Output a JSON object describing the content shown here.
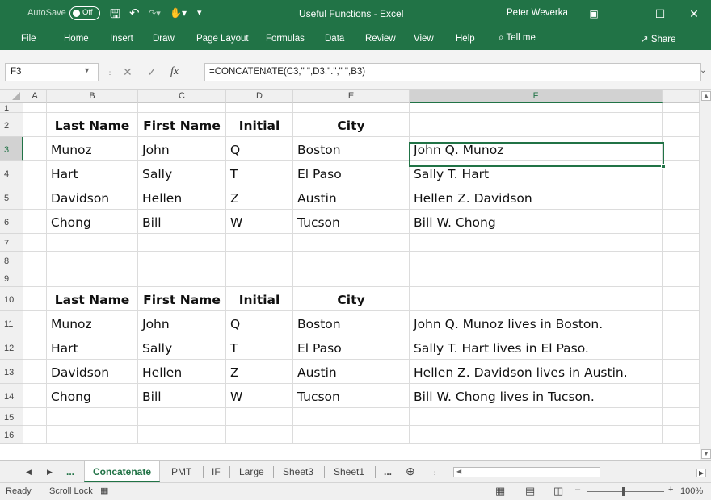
{
  "titlebar": {
    "autosave_label": "AutoSave",
    "autosave_state": "Off",
    "save_icon": "save-icon",
    "undo_icon": "undo-icon",
    "redo_icon": "redo-icon",
    "doc_title": "Useful Functions - Excel",
    "user_name": "Peter Weverka",
    "accent": "#217346"
  },
  "ribbon": {
    "tabs": [
      "File",
      "Home",
      "Insert",
      "Draw",
      "Page Layout",
      "Formulas",
      "Data",
      "Review",
      "View",
      "Help"
    ],
    "tell_me": "Tell me",
    "share": "Share"
  },
  "formula_bar": {
    "name_box": "F3",
    "fx": "fx",
    "formula": "=CONCATENATE(C3,\" \",D3,\".\",\" \",B3)"
  },
  "columns": [
    "A",
    "B",
    "C",
    "D",
    "E",
    "F"
  ],
  "rows": [
    "1",
    "2",
    "3",
    "4",
    "5",
    "6",
    "7",
    "8",
    "9",
    "10",
    "11",
    "12",
    "13",
    "14",
    "15",
    "16"
  ],
  "table1": {
    "headers": [
      "Last Name",
      "First Name",
      "Initial",
      "City"
    ],
    "rows": [
      [
        "Munoz",
        "John",
        "Q",
        "Boston",
        "John Q. Munoz"
      ],
      [
        "Hart",
        "Sally",
        "T",
        "El Paso",
        "Sally T. Hart"
      ],
      [
        "Davidson",
        "Hellen",
        "Z",
        "Austin",
        "Hellen Z. Davidson"
      ],
      [
        "Chong",
        "Bill",
        "W",
        "Tucson",
        "Bill W. Chong"
      ]
    ]
  },
  "table2": {
    "headers": [
      "Last Name",
      "First Name",
      "Initial",
      "City"
    ],
    "rows": [
      [
        "Munoz",
        "John",
        "Q",
        "Boston",
        "John Q. Munoz lives in Boston."
      ],
      [
        "Hart",
        "Sally",
        "T",
        "El Paso",
        "Sally T. Hart lives in El Paso."
      ],
      [
        "Davidson",
        "Hellen",
        "Z",
        "Austin",
        "Hellen Z. Davidson lives in Austin."
      ],
      [
        "Chong",
        "Bill",
        "W",
        "Tucson",
        "Bill W. Chong lives in Tucson."
      ]
    ]
  },
  "sheet_tabs": {
    "ellipsis_left": "...",
    "tabs": [
      "Concatenate",
      "PMT",
      "IF",
      "Large",
      "Sheet3",
      "Sheet1"
    ],
    "active": "Concatenate",
    "ellipsis_right": "..."
  },
  "status": {
    "ready": "Ready",
    "scroll_lock": "Scroll Lock",
    "zoom": "100%"
  }
}
